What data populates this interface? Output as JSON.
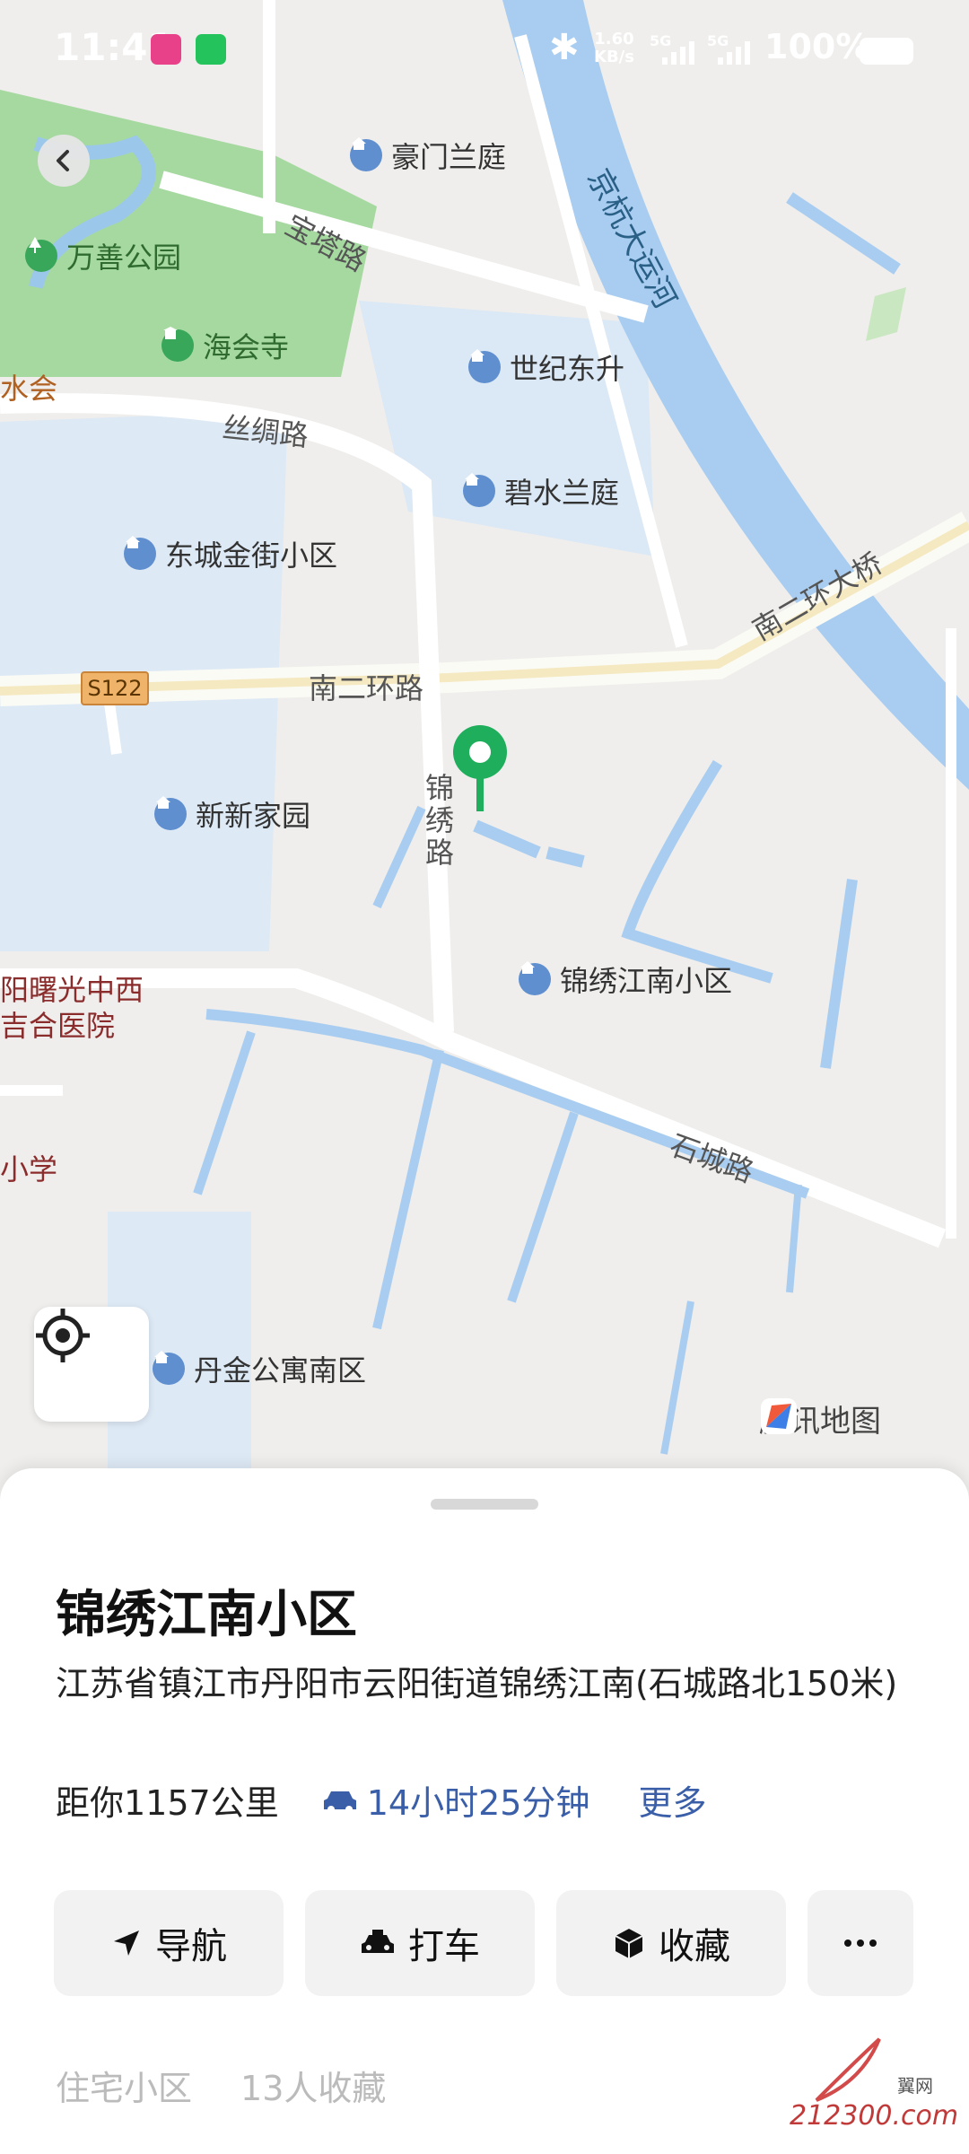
{
  "status_bar": {
    "time": "11:41",
    "speed_value": "1.60",
    "speed_unit": "KB/s",
    "net1": "5G",
    "net2": "5G",
    "battery": "100%"
  },
  "map": {
    "labels": {
      "haomen": "豪门兰庭",
      "wanshan_park": "万善公园",
      "baota_road": "宝塔路",
      "haihui_temple": "海会寺",
      "shuihui": "水会",
      "canal": "京杭大运河",
      "shiji": "世纪东升",
      "sichou_road": "丝绸路",
      "bishui": "碧水兰庭",
      "dongcheng": "东城金街小区",
      "bridge": "南二环大桥",
      "s122": "S122",
      "nan2huan_road": "南二环路",
      "jinxiu_road": "锦\n绣\n路",
      "xinxin": "新新家园",
      "hospital_line1": "阳曙光中西",
      "hospital_line2": "吉合医院",
      "jinxiu_community": "锦绣江南小区",
      "shicheng_road": "石城路",
      "school": "小学",
      "danjin": "丹金公寓南区",
      "tencent_map": "腾讯地图"
    }
  },
  "place": {
    "title": "锦绣江南小区",
    "address": "江苏省镇江市丹阳市云阳街道锦绣江南(石城路北150米)",
    "distance": "距你1157公里",
    "drive_time": "14小时25分钟",
    "more": "更多"
  },
  "actions": {
    "navigate": "导航",
    "taxi": "打车",
    "favorite": "收藏",
    "more_icon": "more-dots-icon"
  },
  "tags": {
    "category": "住宅小区",
    "favorites": "13人收藏"
  },
  "watermark": {
    "site": "212300.com",
    "cn": "翼网"
  },
  "colors": {
    "water": "#a9cdf0",
    "park": "#a6d9a0",
    "pin": "#1fae5b",
    "link_blue": "#3a5fa8"
  }
}
